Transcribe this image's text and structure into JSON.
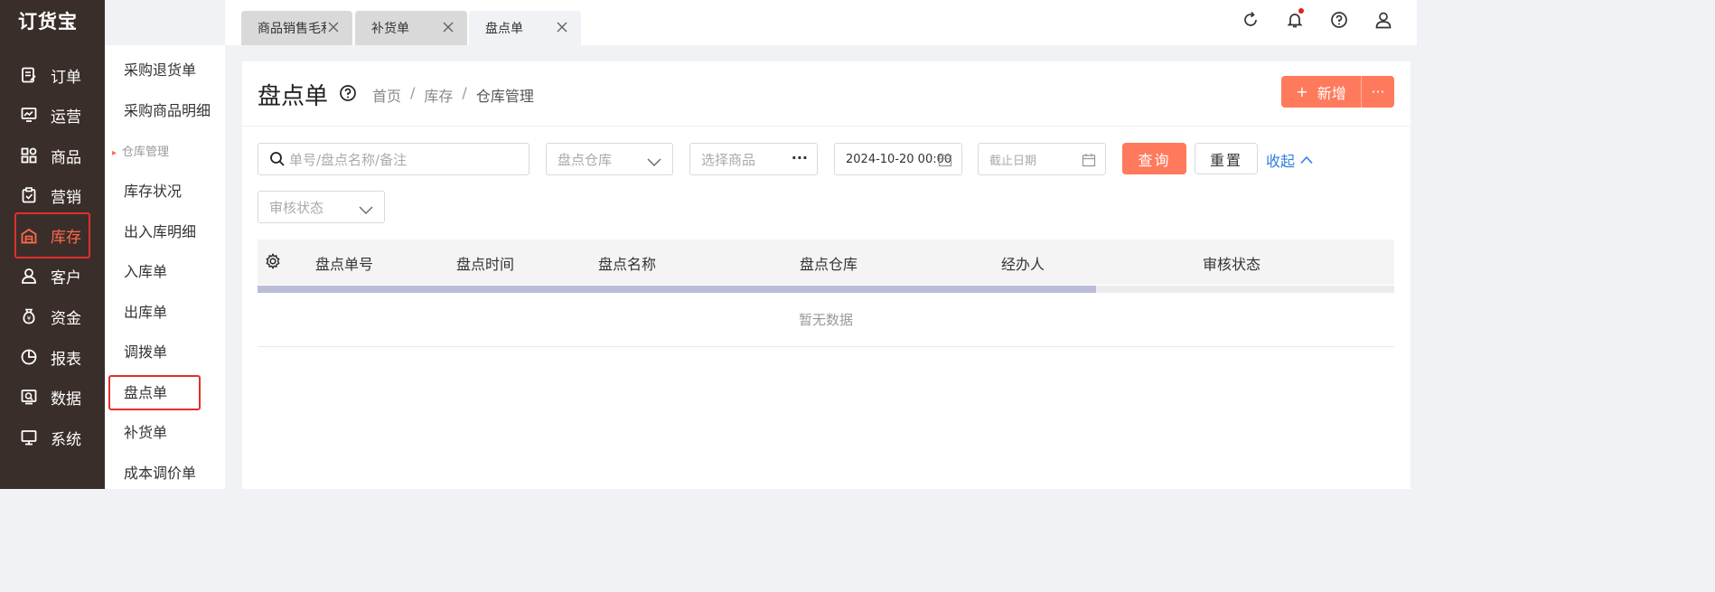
{
  "app": {
    "logo": "订货宝"
  },
  "nav": {
    "items": [
      {
        "label": "订单",
        "icon": "order-icon"
      },
      {
        "label": "运营",
        "icon": "operation-icon"
      },
      {
        "label": "商品",
        "icon": "goods-icon"
      },
      {
        "label": "营销",
        "icon": "marketing-icon"
      },
      {
        "label": "库存",
        "icon": "warehouse-icon",
        "active": true
      },
      {
        "label": "客户",
        "icon": "customer-icon"
      },
      {
        "label": "资金",
        "icon": "money-bag-icon"
      },
      {
        "label": "报表",
        "icon": "pie-chart-icon"
      },
      {
        "label": "数据",
        "icon": "data-search-icon"
      },
      {
        "label": "系统",
        "icon": "monitor-icon"
      }
    ],
    "accent_color": "#ff6a4d"
  },
  "submenu": {
    "items": [
      {
        "label": "采购退货单"
      },
      {
        "label": "采购商品明细"
      },
      {
        "label": "仓库管理",
        "group": true
      },
      {
        "label": "库存状况"
      },
      {
        "label": "出入库明细"
      },
      {
        "label": "入库单"
      },
      {
        "label": "出库单"
      },
      {
        "label": "调拨单"
      },
      {
        "label": "盘点单",
        "active": true
      },
      {
        "label": "补货单"
      },
      {
        "label": "成本调价单"
      }
    ]
  },
  "tabs": [
    {
      "label": "商品销售毛利"
    },
    {
      "label": "补货单"
    },
    {
      "label": "盘点单",
      "active": true
    }
  ],
  "top_icons": [
    "refresh-icon",
    "bell-icon",
    "help-circle-icon",
    "user-icon"
  ],
  "page": {
    "title": "盘点单",
    "breadcrumb": [
      "首页",
      "库存",
      "仓库管理"
    ],
    "add_label": "新增",
    "add_plus": "+",
    "more_label": "···"
  },
  "filters": {
    "search_placeholder": "单号/盘点名称/备注",
    "warehouse_placeholder": "盘点仓库",
    "goods_placeholder": "选择商品",
    "goods_more": "···",
    "start_date_value": "2024-10-20 00:00",
    "end_date_placeholder": "截止日期",
    "status_placeholder": "审核状态",
    "query_label": "查询",
    "reset_label": "重置",
    "collapse_label": "收起"
  },
  "table": {
    "columns": [
      "盘点单号",
      "盘点时间",
      "盘点名称",
      "盘点仓库",
      "经办人",
      "审核状态"
    ],
    "empty_text": "暂无数据"
  },
  "colors": {
    "primary": "#ff7a5c",
    "nav_bg": "#3a2e2a",
    "link": "#2f7fe0"
  }
}
